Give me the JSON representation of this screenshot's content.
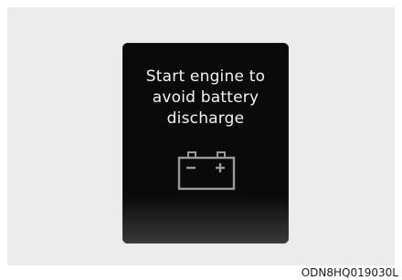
{
  "cluster_message": {
    "line_1": "Start engine to",
    "line_2": "avoid battery",
    "line_3": "discharge"
  },
  "icon": {
    "name": "battery-warning-icon",
    "color": "#9a9a9a"
  },
  "figure_code": "ODN8HQ019030L",
  "colors": {
    "screen_background": "#0a0a0a",
    "message_text": "#f2f2f2",
    "page_background": "#ececec"
  }
}
